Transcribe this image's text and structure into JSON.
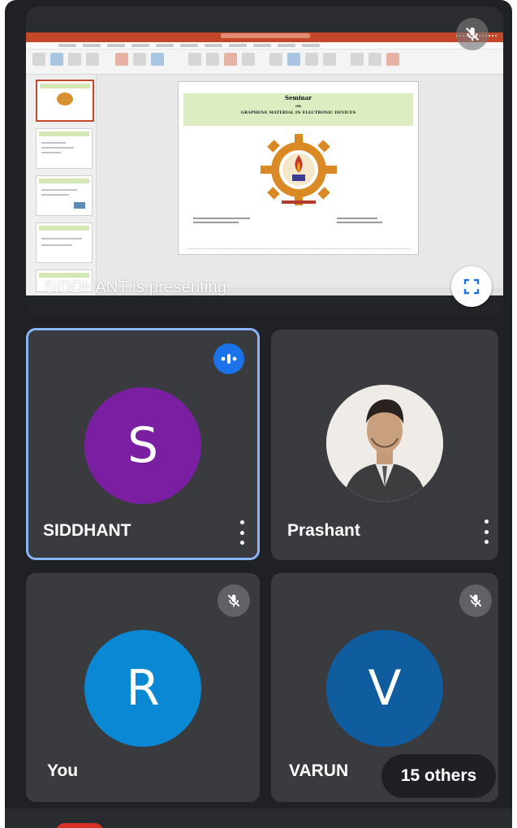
{
  "presentation": {
    "presenter_label": "SIDDHANT is presenting",
    "slide": {
      "title": "Seminar",
      "connector": "on",
      "subtitle": "GRAPHENE MATERIAL IN ELECTRONIC DEVICES"
    },
    "expand_icon": "fullscreen-icon",
    "mute_icon": "mic-off-icon"
  },
  "participants": [
    {
      "initial": "S",
      "name": "SIDDHANT",
      "avatar_color": "#7b1fa2",
      "state": "speaking",
      "status_icon": "audio-level-icon",
      "active": true
    },
    {
      "initial": "",
      "name": "Prashant",
      "avatar": "photo",
      "status_icon": "none"
    },
    {
      "initial": "R",
      "name": "You",
      "avatar_color": "#0b88d4",
      "status_icon": "mic-off-icon"
    },
    {
      "initial": "V",
      "name": "VARUN",
      "avatar_color": "#0f5c9e",
      "status_icon": "mic-off-icon"
    }
  ],
  "others_chip": "15 others",
  "colors": {
    "active_border": "#8ab4f8",
    "speaking_badge": "#1a73e8",
    "background": "#202124"
  }
}
